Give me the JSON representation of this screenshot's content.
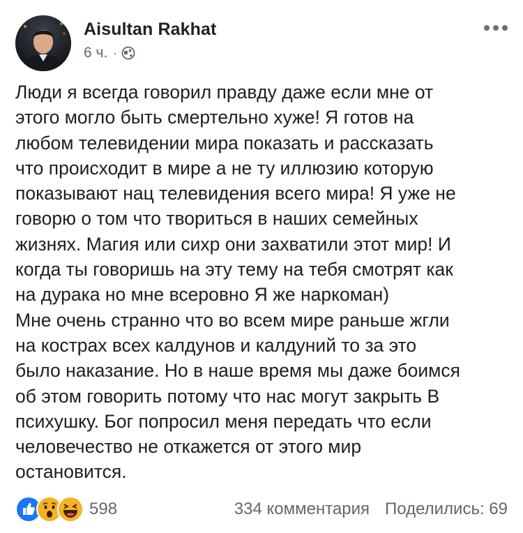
{
  "post": {
    "author": "Aisultan Rakhat",
    "time": "6 ч.",
    "separator": "·",
    "privacy_icon": "globe-icon",
    "menu_icon": "more-options-icon",
    "lines": [
      "Люди я всегда говорил правду даже если мне от",
      "этого могло быть смертельно хуже! Я готов на",
      "любом телевидении мира  показать и рассказать",
      "что происходит в мире а не ту иллюзию которую",
      "показывают нац телевидения всего мира! Я уже не",
      "говорю о том что твориться в наших семейных",
      "жизнях. Магия или сихр они захватили этот мир! И",
      "когда ты говоришь на эту тему на тебя смотрят как",
      "на дурака но мне всеровно Я же наркоман)",
      "Мне очень странно что во всем мире раньше жгли",
      "на кострах всех калдунов и калдуний то за это",
      "было наказание. Но в наше время мы даже боимся",
      "об этом говорить потому что нас могут закрыть В",
      "психушку. Бог попросил меня передать что если",
      "человечество не откажется от этого мир",
      "остановится."
    ]
  },
  "footer": {
    "reactions": [
      "like-icon",
      "wow-icon",
      "haha-icon"
    ],
    "reaction_count": "598",
    "comments": "334 комментария",
    "shares": "Поделились: 69"
  },
  "colors": {
    "text": "#1c1e21",
    "secondary": "#606770",
    "like_blue": "#1877f2",
    "reaction_yellow": "#f7b125"
  }
}
